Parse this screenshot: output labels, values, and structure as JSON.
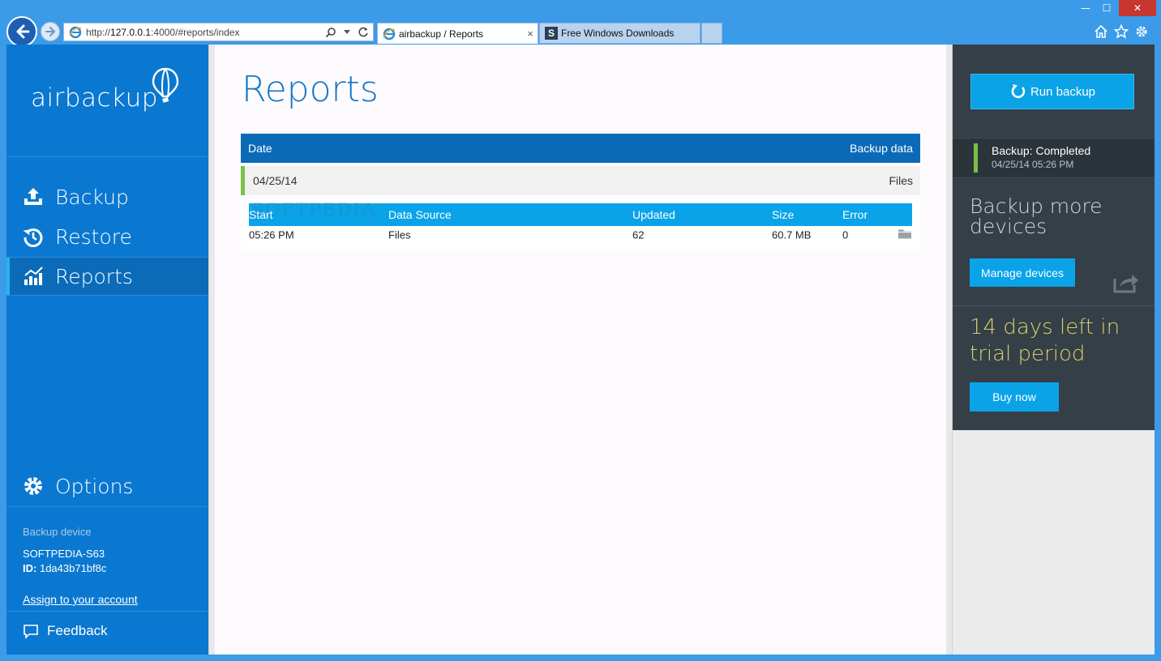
{
  "browser": {
    "url_prefix": "http://",
    "url_host": "127.0.0.1",
    "url_rest": ":4000/#reports/index",
    "tabs": [
      {
        "label": "airbackup / Reports",
        "close": "×"
      },
      {
        "label": "Free Windows Downloads",
        "icon_letter": "S"
      }
    ],
    "window": {
      "minimize": "—",
      "maximize": "☐",
      "close": "✕"
    }
  },
  "sidebar": {
    "brand": "airbackup",
    "nav": {
      "backup": "Backup",
      "restore": "Restore",
      "reports": "Reports",
      "options": "Options"
    },
    "device": {
      "label": "Backup device",
      "name": "SOFTPEDIA-S63",
      "id_label": "ID:",
      "id_value": "1da43b71bf8c",
      "assign_link": "Assign to your account"
    },
    "feedback": "Feedback"
  },
  "main": {
    "title": "Reports",
    "table": {
      "headers": {
        "date": "Date",
        "backup_data": "Backup data"
      },
      "rows": [
        {
          "date": "04/25/14",
          "data": "Files"
        }
      ]
    },
    "detail": {
      "headers": [
        "Start",
        "Data Source",
        "Updated",
        "Size",
        "Error"
      ],
      "rows": [
        [
          "05:26 PM",
          "Files",
          "62",
          "60.7 MB",
          "0"
        ]
      ]
    },
    "watermark": "SOFTPEDIA"
  },
  "right_panel": {
    "run_backup": "Run backup",
    "status_title": "Backup: Completed",
    "status_time": "04/25/14 05:26 PM",
    "more_devices": "Backup more devices",
    "manage_devices": "Manage devices",
    "trial": "14 days left in trial period",
    "buy_now": "Buy now"
  },
  "colors": {
    "sidebar": "#0a78d0",
    "accent": "#0aa3e8",
    "header_dark_blue": "#0b6ab8",
    "success_green": "#7ac143",
    "panel_dark": "#343f47",
    "trial_yellow": "#d7d06a"
  },
  "icons": [
    "back-arrow-icon",
    "forward-arrow-icon",
    "ie-logo-icon",
    "search-icon",
    "refresh-icon",
    "home-icon",
    "star-icon",
    "gear-icon",
    "upload-icon",
    "history-icon",
    "chart-icon",
    "speech-bubble-icon",
    "balloon-icon",
    "folder-icon",
    "share-icon",
    "sync-icon"
  ]
}
